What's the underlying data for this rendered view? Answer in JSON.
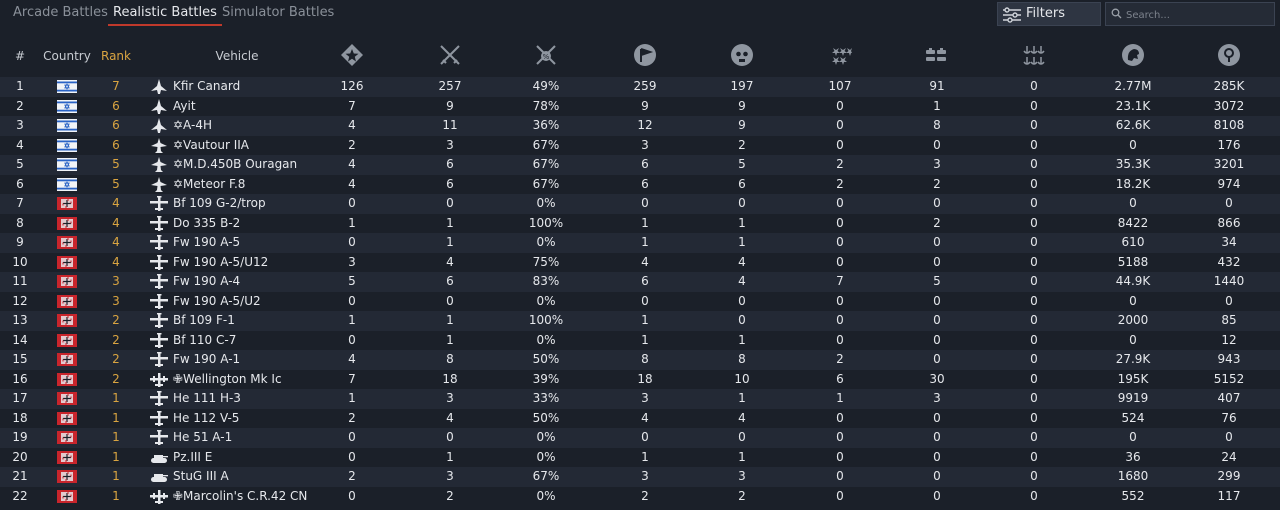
{
  "tabs": [
    {
      "label": "Arcade Battles",
      "active": false
    },
    {
      "label": "Realistic Battles",
      "active": true
    },
    {
      "label": "Simulator Battles",
      "active": false
    }
  ],
  "filters": {
    "label": "Filters"
  },
  "search": {
    "placeholder": "Search..."
  },
  "columns": {
    "index": "#",
    "country": "Country",
    "rank": "Rank",
    "vehicle": "Vehicle",
    "stat_icons": [
      "battles-icon",
      "victories-icon",
      "win-rate-icon",
      "respawns-icon",
      "deaths-icon",
      "air-kills-icon",
      "ground-kills-icon",
      "naval-kills-icon",
      "lions-earned-icon",
      "research-points-icon"
    ]
  },
  "colors": {
    "accent": "#c0392b",
    "rank": "#d9a441"
  },
  "rows": [
    {
      "n": "1",
      "country": "israel",
      "rank": "7",
      "type": "jet",
      "name": "Kfir Canard",
      "stats": [
        "126",
        "257",
        "49%",
        "259",
        "197",
        "107",
        "91",
        "0",
        "2.77M",
        "285K"
      ]
    },
    {
      "n": "2",
      "country": "israel",
      "rank": "6",
      "type": "jet",
      "name": "Ayit",
      "stats": [
        "7",
        "9",
        "78%",
        "9",
        "9",
        "0",
        "1",
        "0",
        "23.1K",
        "3072"
      ]
    },
    {
      "n": "3",
      "country": "israel",
      "rank": "6",
      "type": "jet",
      "name": "✡A-4H",
      "stats": [
        "4",
        "11",
        "36%",
        "12",
        "9",
        "0",
        "8",
        "0",
        "62.6K",
        "8108"
      ]
    },
    {
      "n": "4",
      "country": "israel",
      "rank": "6",
      "type": "jet2",
      "name": "✡Vautour IIA",
      "stats": [
        "2",
        "3",
        "67%",
        "3",
        "2",
        "0",
        "0",
        "0",
        "0",
        "176"
      ]
    },
    {
      "n": "5",
      "country": "israel",
      "rank": "5",
      "type": "jet2",
      "name": "✡M.D.450B Ouragan",
      "stats": [
        "4",
        "6",
        "67%",
        "6",
        "5",
        "2",
        "3",
        "0",
        "35.3K",
        "3201"
      ]
    },
    {
      "n": "6",
      "country": "israel",
      "rank": "5",
      "type": "jet2",
      "name": "✡Meteor F.8",
      "stats": [
        "4",
        "6",
        "67%",
        "6",
        "6",
        "2",
        "2",
        "0",
        "18.2K",
        "974"
      ]
    },
    {
      "n": "7",
      "country": "germany",
      "rank": "4",
      "type": "prop",
      "name": "Bf 109 G-2/trop",
      "stats": [
        "0",
        "0",
        "0%",
        "0",
        "0",
        "0",
        "0",
        "0",
        "0",
        "0"
      ]
    },
    {
      "n": "8",
      "country": "germany",
      "rank": "4",
      "type": "prop",
      "name": "Do 335 B-2",
      "stats": [
        "1",
        "1",
        "100%",
        "1",
        "1",
        "0",
        "2",
        "0",
        "8422",
        "866"
      ]
    },
    {
      "n": "9",
      "country": "germany",
      "rank": "4",
      "type": "prop",
      "name": "Fw 190 A-5",
      "stats": [
        "0",
        "1",
        "0%",
        "1",
        "1",
        "0",
        "0",
        "0",
        "610",
        "34"
      ]
    },
    {
      "n": "10",
      "country": "germany",
      "rank": "4",
      "type": "prop",
      "name": "Fw 190 A-5/U12",
      "stats": [
        "3",
        "4",
        "75%",
        "4",
        "4",
        "0",
        "0",
        "0",
        "5188",
        "432"
      ]
    },
    {
      "n": "11",
      "country": "germany",
      "rank": "3",
      "type": "prop",
      "name": "Fw 190 A-4",
      "stats": [
        "5",
        "6",
        "83%",
        "6",
        "4",
        "7",
        "5",
        "0",
        "44.9K",
        "1440"
      ]
    },
    {
      "n": "12",
      "country": "germany",
      "rank": "3",
      "type": "prop",
      "name": "Fw 190 A-5/U2",
      "stats": [
        "0",
        "0",
        "0%",
        "0",
        "0",
        "0",
        "0",
        "0",
        "0",
        "0"
      ]
    },
    {
      "n": "13",
      "country": "germany",
      "rank": "2",
      "type": "prop",
      "name": "Bf 109 F-1",
      "stats": [
        "1",
        "1",
        "100%",
        "1",
        "0",
        "0",
        "0",
        "0",
        "2000",
        "85"
      ]
    },
    {
      "n": "14",
      "country": "germany",
      "rank": "2",
      "type": "prop",
      "name": "Bf 110 C-7",
      "stats": [
        "0",
        "1",
        "0%",
        "1",
        "1",
        "0",
        "0",
        "0",
        "0",
        "12"
      ]
    },
    {
      "n": "15",
      "country": "germany",
      "rank": "2",
      "type": "prop",
      "name": "Fw 190 A-1",
      "stats": [
        "4",
        "8",
        "50%",
        "8",
        "8",
        "2",
        "0",
        "0",
        "27.9K",
        "943"
      ]
    },
    {
      "n": "16",
      "country": "germany",
      "rank": "2",
      "type": "bomber",
      "name": "✙Wellington Mk Ic",
      "stats": [
        "7",
        "18",
        "39%",
        "18",
        "10",
        "6",
        "30",
        "0",
        "195K",
        "5152"
      ]
    },
    {
      "n": "17",
      "country": "germany",
      "rank": "1",
      "type": "prop",
      "name": "He 111 H-3",
      "stats": [
        "1",
        "3",
        "33%",
        "3",
        "1",
        "1",
        "3",
        "0",
        "9919",
        "407"
      ]
    },
    {
      "n": "18",
      "country": "germany",
      "rank": "1",
      "type": "prop",
      "name": "He 112 V-5",
      "stats": [
        "2",
        "4",
        "50%",
        "4",
        "4",
        "0",
        "0",
        "0",
        "524",
        "76"
      ]
    },
    {
      "n": "19",
      "country": "germany",
      "rank": "1",
      "type": "prop",
      "name": "He 51 A-1",
      "stats": [
        "0",
        "0",
        "0%",
        "0",
        "0",
        "0",
        "0",
        "0",
        "0",
        "0"
      ]
    },
    {
      "n": "20",
      "country": "germany",
      "rank": "1",
      "type": "tank",
      "name": "Pz.III E",
      "stats": [
        "0",
        "1",
        "0%",
        "1",
        "1",
        "0",
        "0",
        "0",
        "36",
        "24"
      ]
    },
    {
      "n": "21",
      "country": "germany",
      "rank": "1",
      "type": "tank",
      "name": "StuG III A",
      "stats": [
        "2",
        "3",
        "67%",
        "3",
        "3",
        "0",
        "0",
        "0",
        "1680",
        "299"
      ]
    },
    {
      "n": "22",
      "country": "germany",
      "rank": "1",
      "type": "bomber",
      "name": "✙Marcolin's C.R.42 CN",
      "stats": [
        "0",
        "2",
        "0%",
        "2",
        "2",
        "0",
        "0",
        "0",
        "552",
        "117"
      ]
    }
  ]
}
